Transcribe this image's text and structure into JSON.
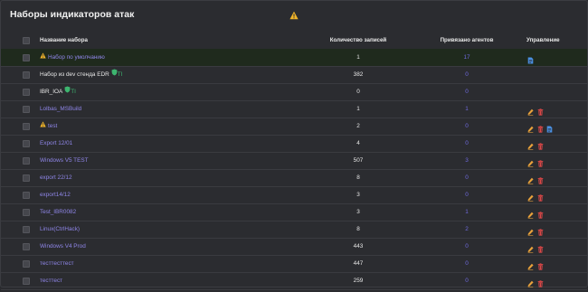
{
  "title": "Наборы индикаторов атак",
  "headers": {
    "name": "Название набора",
    "count": "Количество записей",
    "agents": "Привязано агентов",
    "manage": "Управление"
  },
  "rows": [
    {
      "name": "Набор по умолчанию",
      "warn": true,
      "count": "1",
      "agents": "17",
      "link": true,
      "shield": false,
      "ti": "",
      "actions": [
        "export"
      ],
      "selected": true
    },
    {
      "name": "Набор из dev стенда EDR",
      "warn": false,
      "count": "382",
      "agents": "0",
      "link": false,
      "shield": true,
      "ti": "TI",
      "actions": [],
      "selected": false
    },
    {
      "name": "IBR_IOA",
      "warn": false,
      "count": "0",
      "agents": "0",
      "link": false,
      "shield": true,
      "ti": "TI",
      "actions": [],
      "selected": false
    },
    {
      "name": "Lolbas_MSBuild",
      "warn": false,
      "count": "1",
      "agents": "1",
      "link": true,
      "shield": false,
      "ti": "",
      "actions": [
        "edit",
        "delete"
      ],
      "selected": false
    },
    {
      "name": "test",
      "warn": true,
      "count": "2",
      "agents": "0",
      "link": true,
      "shield": false,
      "ti": "",
      "actions": [
        "edit",
        "delete",
        "export"
      ],
      "selected": false
    },
    {
      "name": "Export 12/01",
      "warn": false,
      "count": "4",
      "agents": "0",
      "link": true,
      "shield": false,
      "ti": "",
      "actions": [
        "edit",
        "delete"
      ],
      "selected": false
    },
    {
      "name": "Windows V5 TEST",
      "warn": false,
      "count": "507",
      "agents": "3",
      "link": true,
      "shield": false,
      "ti": "",
      "actions": [
        "edit",
        "delete"
      ],
      "selected": false
    },
    {
      "name": "export 22/12",
      "warn": false,
      "count": "8",
      "agents": "0",
      "link": true,
      "shield": false,
      "ti": "",
      "actions": [
        "edit",
        "delete"
      ],
      "selected": false
    },
    {
      "name": "export14/12",
      "warn": false,
      "count": "3",
      "agents": "0",
      "link": true,
      "shield": false,
      "ti": "",
      "actions": [
        "edit",
        "delete"
      ],
      "selected": false
    },
    {
      "name": "Test_IBR0082",
      "warn": false,
      "count": "3",
      "agents": "1",
      "link": true,
      "shield": false,
      "ti": "",
      "actions": [
        "edit",
        "delete"
      ],
      "selected": false
    },
    {
      "name": "Linux(CtrlHack)",
      "warn": false,
      "count": "8",
      "agents": "2",
      "link": true,
      "shield": false,
      "ti": "",
      "actions": [
        "edit",
        "delete"
      ],
      "selected": false
    },
    {
      "name": "Windows V4 Prod",
      "warn": false,
      "count": "443",
      "agents": "0",
      "link": true,
      "shield": false,
      "ti": "",
      "actions": [
        "edit",
        "delete"
      ],
      "selected": false
    },
    {
      "name": "тесттесттест",
      "warn": false,
      "count": "447",
      "agents": "0",
      "link": true,
      "shield": false,
      "ti": "",
      "actions": [
        "edit",
        "delete"
      ],
      "selected": false
    },
    {
      "name": "тесттест",
      "warn": false,
      "count": "259",
      "agents": "0",
      "link": true,
      "shield": false,
      "ti": "",
      "actions": [
        "edit",
        "delete"
      ],
      "selected": false
    }
  ],
  "colors": {
    "link": "#8f86e8",
    "warn": "#f0b429",
    "edit": "#e9a23b",
    "delete": "#e04848",
    "export": "#4a90e2",
    "ti": "#3db56f"
  }
}
